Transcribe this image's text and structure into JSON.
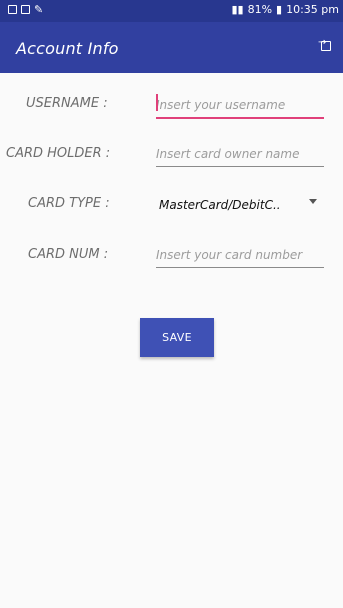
{
  "status_bar": {
    "battery": "81%",
    "time": "10:35 pm"
  },
  "toolbar": {
    "title": "Account Info",
    "action_icon": "logout-icon"
  },
  "form": {
    "username": {
      "label": "USERNAME :",
      "placeholder": "Insert your username",
      "value": ""
    },
    "card_holder": {
      "label": "CARD HOLDER :",
      "placeholder": "Insert card owner name",
      "value": ""
    },
    "card_type": {
      "label": "CARD TYPE :",
      "selected": "MasterCard/DebitC.."
    },
    "card_num": {
      "label": "CARD NUM :",
      "placeholder": "Insert your card number",
      "value": ""
    }
  },
  "save_label": "SAVE",
  "colors": {
    "appbar": "#3140a0",
    "statusbar": "#28378f",
    "button": "#3f51b5",
    "focus_accent": "#e0407a"
  }
}
